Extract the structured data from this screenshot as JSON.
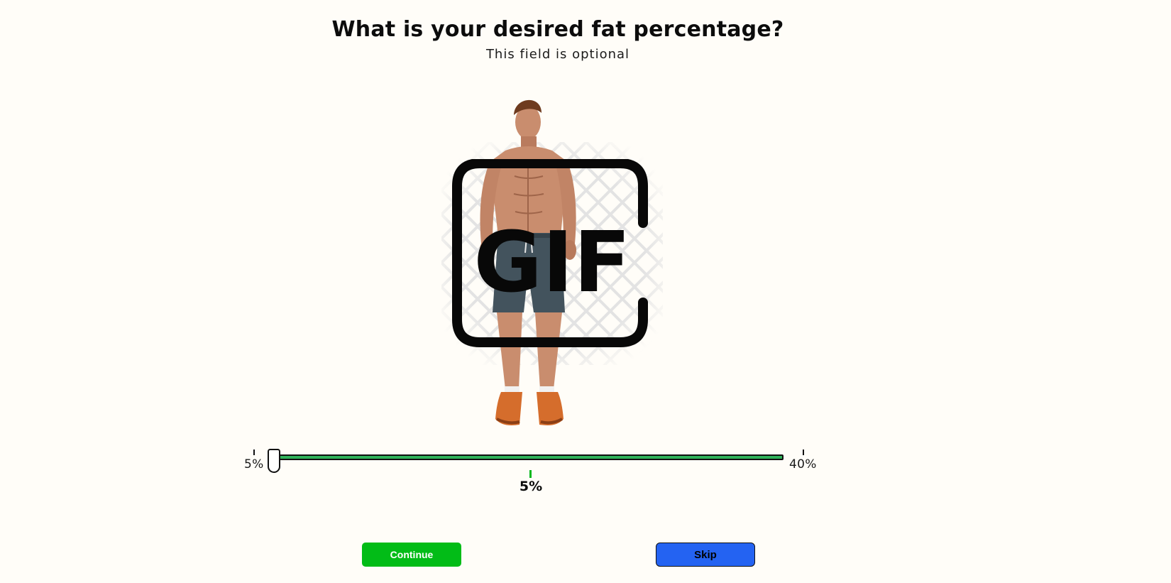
{
  "page": {
    "title": "What is your desired fat percentage?",
    "subtitle": "This field is optional"
  },
  "media": {
    "image_description": "muscular man in shorts and sneakers",
    "overlay_icon": "gif-icon",
    "overlay_text": "GIF"
  },
  "slider": {
    "min_label": "5%",
    "max_label": "40%",
    "min": 5,
    "max": 40,
    "value": 5,
    "value_label": "5%",
    "track_color": "#2fb35a",
    "indicator_color": "#07b81d"
  },
  "actions": {
    "continue_label": "Continue",
    "skip_label": "Skip",
    "continue_color": "#02bc17",
    "skip_color": "#2463f2"
  }
}
